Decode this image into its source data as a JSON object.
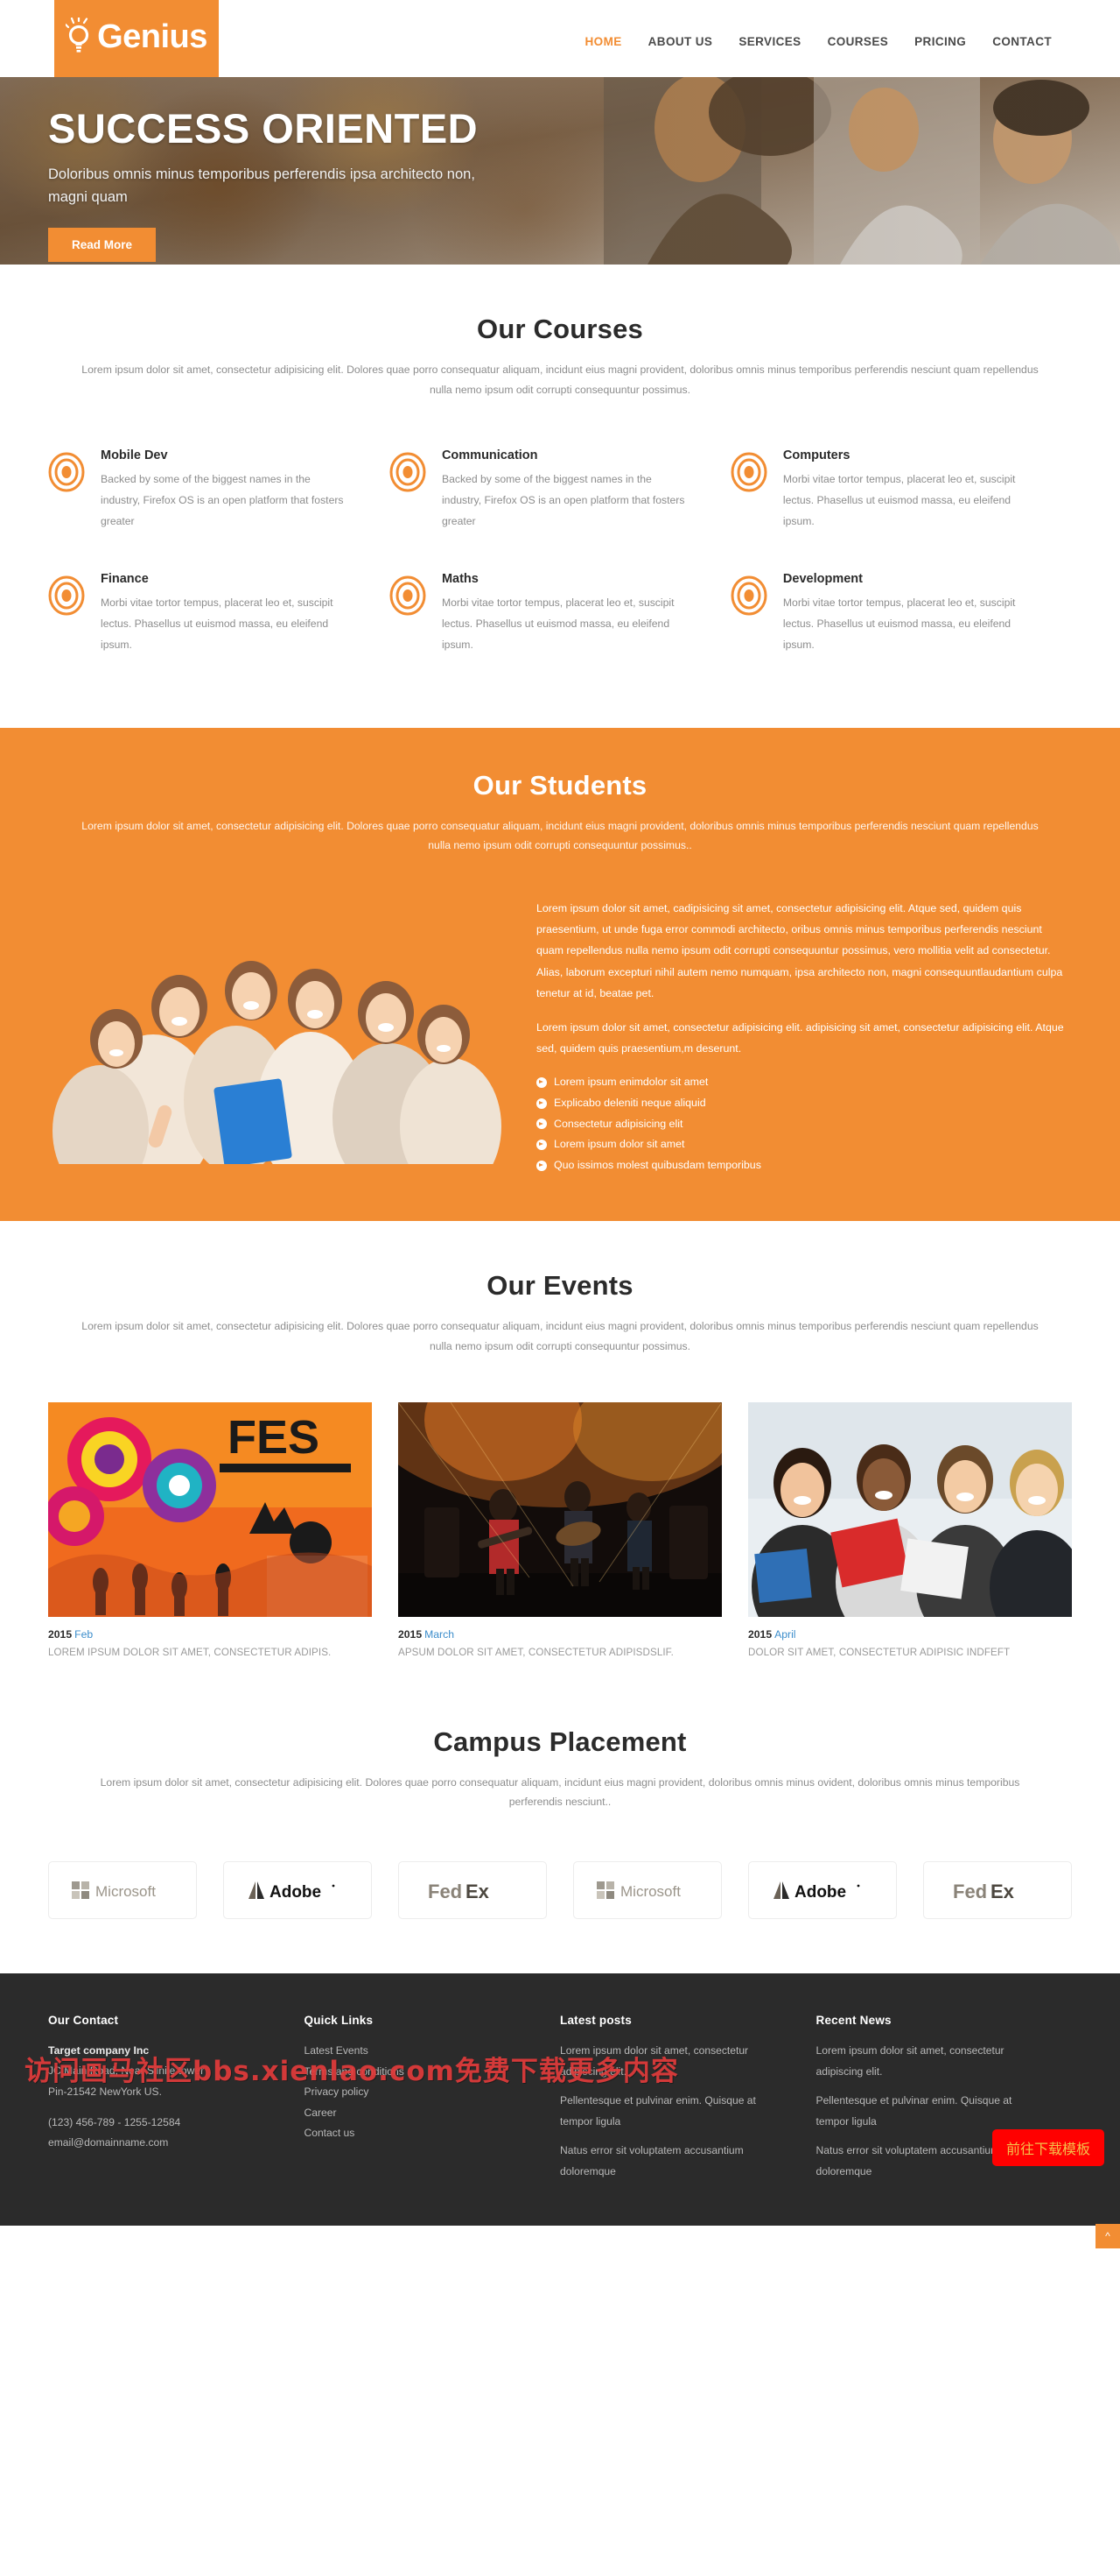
{
  "header": {
    "logo_text": "Genius",
    "logo_icon": "lightbulb-icon",
    "nav": [
      {
        "label": "HOME",
        "active": true
      },
      {
        "label": "ABOUT US",
        "active": false
      },
      {
        "label": "SERVICES",
        "active": false
      },
      {
        "label": "COURSES",
        "active": false
      },
      {
        "label": "PRICING",
        "active": false
      },
      {
        "label": "CONTACT",
        "active": false
      }
    ]
  },
  "hero": {
    "title": "SUCCESS ORIENTED",
    "subtitle": "Doloribus omnis minus temporibus perferendis ipsa architecto non, magni quam",
    "button": "Read More"
  },
  "courses": {
    "title": "Our Courses",
    "subtitle": "Lorem ipsum dolor sit amet, consectetur adipisicing elit. Dolores quae porro consequatur aliquam, incidunt eius magni provident, doloribus omnis minus temporibus perferendis nesciunt quam repellendus nulla nemo ipsum odit corrupti consequuntur possimus.",
    "items": [
      {
        "title": "Mobile Dev",
        "text": "Backed by some of the biggest names in the industry, Firefox OS is an open platform that fosters greater"
      },
      {
        "title": "Communication",
        "text": "Backed by some of the biggest names in the industry, Firefox OS is an open platform that fosters greater"
      },
      {
        "title": "Computers",
        "text": "Morbi vitae tortor tempus, placerat leo et, suscipit lectus. Phasellus ut euismod massa, eu eleifend ipsum."
      },
      {
        "title": "Finance",
        "text": "Morbi vitae tortor tempus, placerat leo et, suscipit lectus. Phasellus ut euismod massa, eu eleifend ipsum."
      },
      {
        "title": "Maths",
        "text": "Morbi vitae tortor tempus, placerat leo et, suscipit lectus. Phasellus ut euismod massa, eu eleifend ipsum."
      },
      {
        "title": "Development",
        "text": "Morbi vitae tortor tempus, placerat leo et, suscipit lectus. Phasellus ut euismod massa, eu eleifend ipsum."
      }
    ]
  },
  "students": {
    "title": "Our Students",
    "subtitle": "Lorem ipsum dolor sit amet, consectetur adipisicing elit. Dolores quae porro consequatur aliquam, incidunt eius magni provident, doloribus omnis minus temporibus perferendis nesciunt quam repellendus nulla nemo ipsum odit corrupti consequuntur possimus..",
    "paragraph1": "Lorem ipsum dolor sit amet, cadipisicing sit amet, consectetur adipisicing elit. Atque sed, quidem quis praesentium, ut unde fuga error commodi architecto, oribus omnis minus temporibus perferendis nesciunt quam repellendus nulla nemo ipsum odit corrupti consequuntur possimus, vero mollitia velit ad consectetur. Alias, laborum excepturi nihil autem nemo numquam, ipsa architecto non, magni consequuntlaudantium culpa tenetur at id, beatae pet.",
    "paragraph2": "Lorem ipsum dolor sit amet, consectetur adipisicing elit. adipisicing sit amet, consectetur adipisicing elit. Atque sed, quidem quis praesentium,m deserunt.",
    "list": [
      "Lorem ipsum enimdolor sit amet",
      "Explicabo deleniti neque aliquid",
      "Consectetur adipisicing elit",
      "Lorem ipsum dolor sit amet",
      "Quo issimos molest quibusdam temporibus"
    ]
  },
  "events": {
    "title": "Our Events",
    "subtitle": "Lorem ipsum dolor sit amet, consectetur adipisicing elit. Dolores quae porro consequatur aliquam, incidunt eius magni provident, doloribus omnis minus temporibus perferendis nesciunt quam repellendus nulla nemo ipsum odit corrupti consequuntur possimus.",
    "items": [
      {
        "year": "2015",
        "month": "Feb",
        "desc": "LOREM IPSUM DOLOR SIT AMET, CONSECTETUR ADIPIS.",
        "image": "festival-poster-image"
      },
      {
        "year": "2015",
        "month": "March",
        "desc": "APSUM DOLOR SIT AMET, CONSECTETUR ADIPISDSLIF.",
        "image": "concert-stage-image"
      },
      {
        "year": "2015",
        "month": "April",
        "desc": "DOLOR SIT AMET, CONSECTETUR ADIPISIC INDFEFT",
        "image": "students-group-image"
      }
    ]
  },
  "placement": {
    "title": "Campus Placement",
    "subtitle": "Lorem ipsum dolor sit amet, consectetur adipisicing elit. Dolores quae porro consequatur aliquam, incidunt eius magni provident, doloribus omnis minus ovident, doloribus omnis minus temporibus perferendis nesciunt..",
    "logos": [
      "Microsoft",
      "Adobe",
      "FedEx",
      "Microsoft",
      "Adobe",
      "FedEx"
    ]
  },
  "footer": {
    "contact": {
      "heading": "Our Contact",
      "company": "Target company Inc",
      "address1": "JC Main Road, Near Silnile tower",
      "address2": "Pin-21542 NewYork US.",
      "phone": "(123) 456-789 - 1255-12584",
      "email": "email@domainname.com"
    },
    "quick_links": {
      "heading": "Quick Links",
      "items": [
        "Latest Events",
        "Terms and conditions",
        "Privacy policy",
        "Career",
        "Contact us"
      ]
    },
    "latest_posts": {
      "heading": "Latest posts",
      "items": [
        "Lorem ipsum dolor sit amet, consectetur adipiscing elit.",
        "Pellentesque et pulvinar enim. Quisque at tempor ligula",
        "Natus error sit voluptatem accusantium doloremque"
      ]
    },
    "recent_news": {
      "heading": "Recent News",
      "items": [
        "Lorem ipsum dolor sit amet, consectetur adipiscing elit.",
        "Pellentesque et pulvinar enim. Quisque at tempor ligula",
        "Natus error sit voluptatem accusantium doloremque"
      ]
    }
  },
  "overlay": {
    "watermark": "访问画马社区bbs.xienlao.com免费下载更多内容",
    "download_badge": "前往下载模板",
    "to_top": "^"
  },
  "colors": {
    "accent": "#f28d33",
    "footer_bg": "#2b2b2b",
    "link_blue": "#3c8dcb",
    "badge_red": "#ff0000"
  }
}
